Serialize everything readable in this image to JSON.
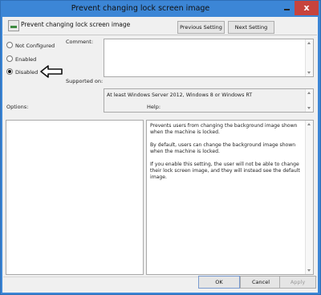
{
  "window": {
    "title": "Prevent changing lock screen image",
    "close_label": "x"
  },
  "header": {
    "setting_name": "Prevent changing lock screen image"
  },
  "nav": {
    "previous_label": "Previous Setting",
    "next_label": "Next Setting"
  },
  "state": {
    "options": [
      {
        "label": "Not Configured",
        "selected": false
      },
      {
        "label": "Enabled",
        "selected": false
      },
      {
        "label": "Disabled",
        "selected": true
      }
    ]
  },
  "comment": {
    "label": "Comment:",
    "value": ""
  },
  "supported": {
    "label": "Supported on:",
    "value": "At least Windows Server 2012, Windows 8 or Windows RT"
  },
  "options_panel": {
    "label": "Options:"
  },
  "help_panel": {
    "label": "Help:",
    "paragraphs": [
      "Prevents users from changing the background image shown when the machine is locked.",
      "By default, users can change the background image shown when the machine is locked.",
      "If you enable this setting, the user will not be able to change their lock screen image, and they will instead see the default image."
    ]
  },
  "footer": {
    "ok_label": "OK",
    "cancel_label": "Cancel",
    "apply_label": "Apply"
  },
  "colors": {
    "titlebar": "#3c86d6",
    "close": "#c7433d",
    "client": "#f0f0f0"
  },
  "icons": [
    "policy-icon",
    "arrow-annotation-icon",
    "minimize-icon",
    "close-icon"
  ]
}
